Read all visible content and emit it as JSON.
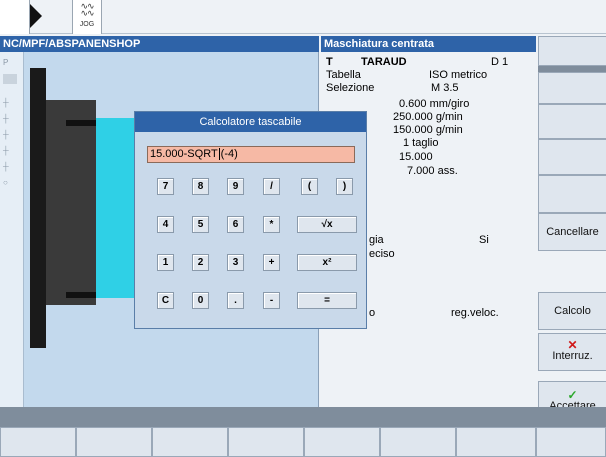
{
  "top": {
    "mode_glyph": "ww\nww",
    "jog_label": "JOG"
  },
  "headers": {
    "path": "NC/MPF/ABSPANENSHOP",
    "title": "Maschiatura centrata"
  },
  "params": {
    "t_label": "T",
    "t_value": "TARAUD",
    "d_value": "D 1",
    "tabella_label": "Tabella",
    "tabella_value": "ISO metrico",
    "selezione_label": "Selezione",
    "selezione_value": "M 3.5",
    "row1": "0.600 mm/giro",
    "row2": "250.000 g/min",
    "row3": "150.000 g/min",
    "row4": "1 taglio",
    "row5": "15.000",
    "row6": "7.000 ass.",
    "row7_label": "gia",
    "row7_value": "Si",
    "row8": "eciso",
    "row9_label": "o",
    "row9_value": "reg.veloc."
  },
  "dialog": {
    "title": "Calcolatore tascabile",
    "input_before": "15.000-SQRT",
    "input_after": "(-4)",
    "keys_row1": [
      "7",
      "8",
      "9",
      "/",
      "(",
      ")"
    ],
    "keys_row2": [
      "4",
      "5",
      "6",
      "*",
      "√x"
    ],
    "keys_row3": [
      "1",
      "2",
      "3",
      "+",
      "x²"
    ],
    "keys_row4": [
      "C",
      "0",
      ".",
      "-",
      "="
    ]
  },
  "softkeys": {
    "cancellare": "Cancellare",
    "calcolo": "Calcolo",
    "interruz": "Interruz.",
    "accettare": "Accettare"
  },
  "colors": {
    "header": "#2e63a8",
    "input_bg": "#f6b9a5",
    "interrupt": "#d01818",
    "accept": "#2aa82a"
  }
}
